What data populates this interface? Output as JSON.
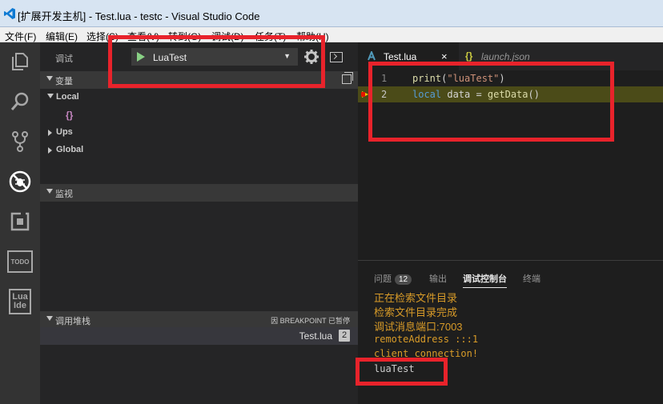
{
  "window": {
    "title": "[扩展开发主机] - Test.lua - testc - Visual Studio Code"
  },
  "menu": [
    "文件(F)",
    "编辑(E)",
    "选择(S)",
    "查看(V)",
    "转到(G)",
    "调试(D)",
    "任务(T)",
    "帮助(H)"
  ],
  "activity_bar": {
    "items": [
      "explorer-icon",
      "search-icon",
      "source-control-icon",
      "debug-icon",
      "extensions-icon",
      "todo-icon",
      "lua-ide-icon"
    ],
    "todo_label": "TODO",
    "lua_label_1": "Lua",
    "lua_label_2": "Ide"
  },
  "debug": {
    "label": "调试",
    "config_name": "LuaTest",
    "variables_header": "变量",
    "scopes": [
      "Local",
      "Ups",
      "Global"
    ],
    "local_value": "{}",
    "watch_header": "监视",
    "callstack_header": "调用堆栈",
    "pause_reason": "因 BREAKPOINT 已暂停",
    "frame_name": "Test.lua",
    "frame_line": "2"
  },
  "editor": {
    "tabs": [
      {
        "label": "Test.lua",
        "active": true
      },
      {
        "label": "launch.json",
        "active": false
      }
    ],
    "lines": [
      {
        "num": "1",
        "tokens": [
          {
            "t": "print",
            "c": "#dcdcaa"
          },
          {
            "t": "(",
            "c": "#d4d4d4"
          },
          {
            "t": "\"luaTest\"",
            "c": "#ce9178"
          },
          {
            "t": ")",
            "c": "#d4d4d4"
          }
        ]
      },
      {
        "num": "2",
        "tokens": [
          {
            "t": "local",
            "c": "#569cd6"
          },
          {
            "t": " data = ",
            "c": "#d4d4d4"
          },
          {
            "t": "getData",
            "c": "#dcdcaa"
          },
          {
            "t": "()",
            "c": "#d4d4d4"
          }
        ]
      }
    ],
    "highlight_color": "#4b4b18"
  },
  "panel": {
    "tabs": [
      "问题",
      "输出",
      "调试控制台",
      "终端"
    ],
    "problems_count": "12",
    "output": [
      "正在检索文件目录",
      "检索文件目录完成",
      "调试消息端口:7003",
      "remoteAddress :::1",
      "client connection!",
      "luaTest"
    ]
  },
  "colors": {
    "annotation_red": "#e8232b",
    "accent_orange": "#d89b28"
  }
}
